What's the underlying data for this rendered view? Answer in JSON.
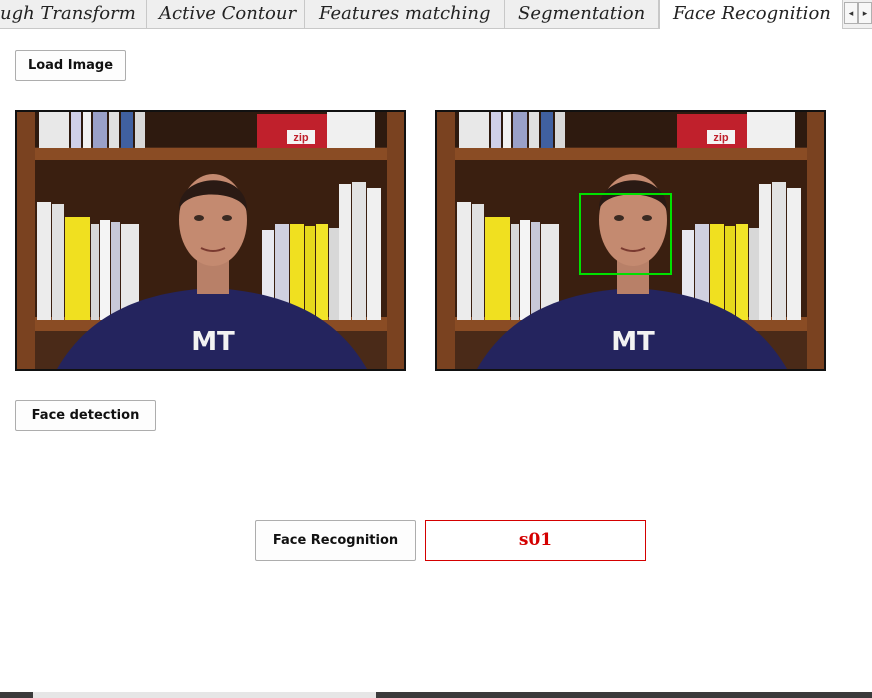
{
  "tabs": [
    {
      "label": "ugh Transform",
      "active": false
    },
    {
      "label": "Active Contour",
      "active": false
    },
    {
      "label": "Features matching",
      "active": false
    },
    {
      "label": "Segmentation",
      "active": false
    },
    {
      "label": "Face Recognition",
      "active": true
    }
  ],
  "tab_scroll": {
    "left": "◂",
    "right": "▸"
  },
  "buttons": {
    "load_image": "Load Image",
    "face_detection": "Face detection",
    "face_recognition": "Face Recognition"
  },
  "recognition_result": "s01",
  "book_label": "zip",
  "shirt_logo": "MT",
  "colors": {
    "result_accent": "#d40000",
    "detection_box": "#00e000",
    "shirt": "#24245e"
  }
}
